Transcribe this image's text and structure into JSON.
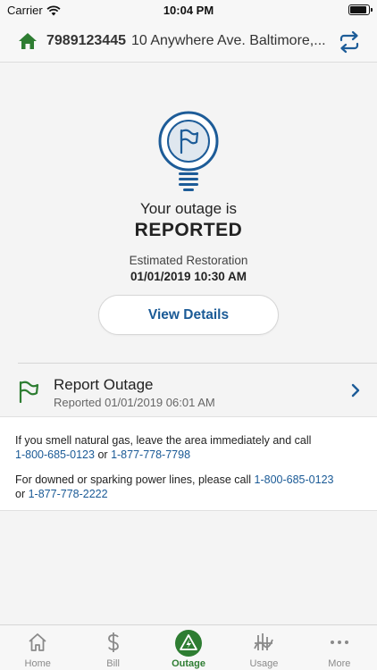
{
  "status_bar": {
    "carrier": "Carrier",
    "time": "10:04 PM"
  },
  "account": {
    "number": "7989123445",
    "address": "10 Anywhere Ave. Baltimore,..."
  },
  "outage": {
    "line1": "Your outage is",
    "status": "REPORTED",
    "restoration_label": "Estimated Restoration",
    "restoration_value": "01/01/2019 10:30 AM",
    "view_details_label": "View Details"
  },
  "report": {
    "title": "Report Outage",
    "subtitle": "Reported 01/01/2019 06:01 AM"
  },
  "notice": {
    "gas_text": "If you smell natural gas, leave the area immediately and call",
    "gas_phone1": "1-800-685-0123",
    "or1": "or",
    "gas_phone2": "1-877-778-7798",
    "lines_text": "For downed or sparking power lines, please call",
    "lines_phone1": "1-800-685-0123",
    "or2": "or",
    "lines_phone2": "1-877-778-2222"
  },
  "tabs": [
    {
      "label": "Home",
      "icon": "house-icon"
    },
    {
      "label": "Bill",
      "icon": "dollar-icon"
    },
    {
      "label": "Outage",
      "icon": "outage-bolt-icon",
      "active": true
    },
    {
      "label": "Usage",
      "icon": "usage-meter-icon"
    },
    {
      "label": "More",
      "icon": "ellipsis-icon"
    }
  ],
  "colors": {
    "brand_green": "#2e7d32",
    "link_blue": "#1a5a96",
    "bulb_blue": "#1d5c98"
  }
}
